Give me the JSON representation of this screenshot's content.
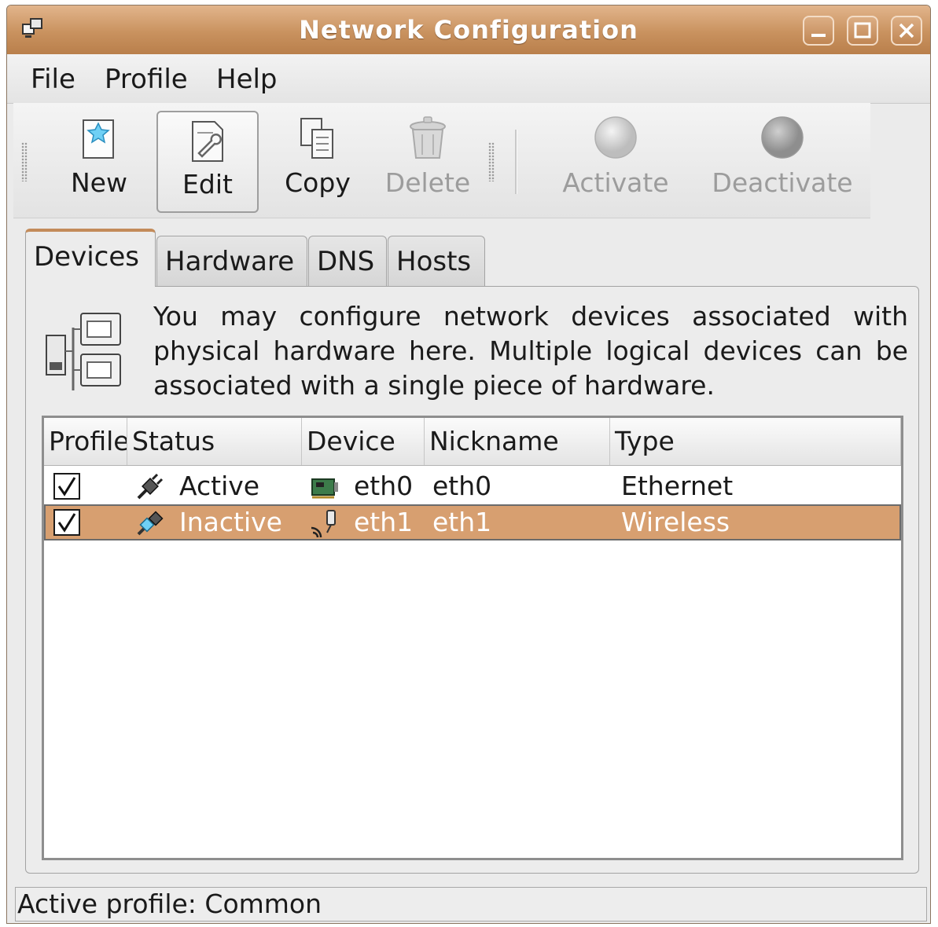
{
  "window": {
    "title": "Network Configuration"
  },
  "menu": {
    "file": "File",
    "profile": "Profile",
    "help": "Help"
  },
  "toolbar": {
    "new": "New",
    "edit": "Edit",
    "copy": "Copy",
    "delete": "Delete",
    "activate": "Activate",
    "deactivate": "Deactivate"
  },
  "tabs": {
    "devices": "Devices",
    "hardware": "Hardware",
    "dns": "DNS",
    "hosts": "Hosts"
  },
  "panel": {
    "info": "You may configure network devices associated with physical hardware here.  Multiple logical devices can be associated with a single piece of hardware."
  },
  "table": {
    "columns": {
      "profile": "Profile",
      "status": "Status",
      "device": "Device",
      "nickname": "Nickname",
      "type": "Type"
    },
    "rows": [
      {
        "profile_checked": "✓",
        "status": "Active",
        "device": "eth0",
        "nickname": "eth0",
        "type": "Ethernet"
      },
      {
        "profile_checked": "✓",
        "status": "Inactive",
        "device": "eth1",
        "nickname": "eth1",
        "type": "Wireless"
      }
    ]
  },
  "statusbar": {
    "text": "Active profile: Common"
  },
  "colors": {
    "accent": "#c38b5a",
    "selection": "#d79f70",
    "titlebar": "#c9925f"
  }
}
